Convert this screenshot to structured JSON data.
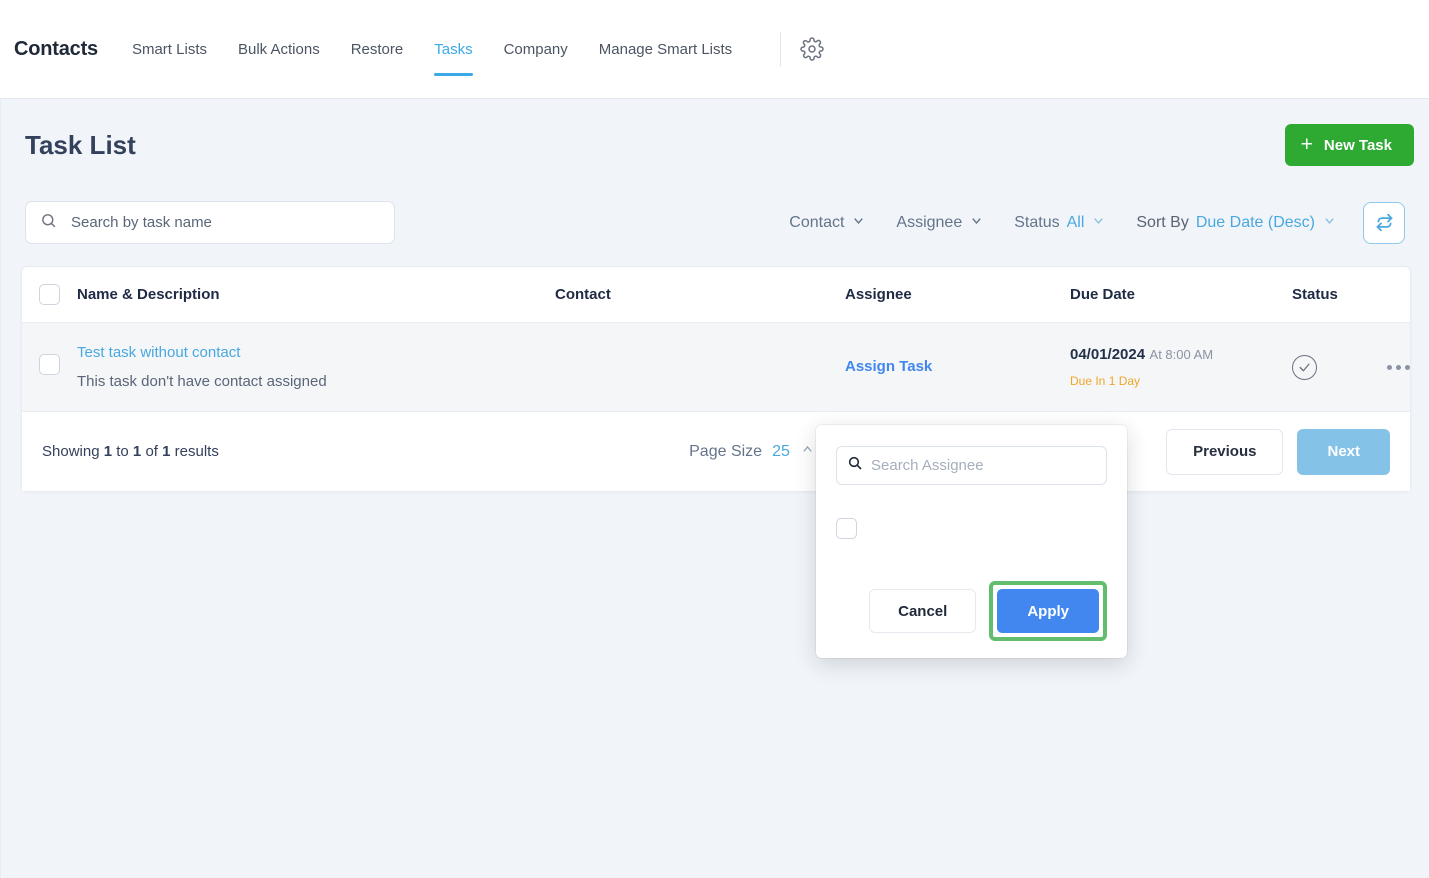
{
  "nav": {
    "brand": "Contacts",
    "items": [
      {
        "label": "Smart Lists",
        "active": false
      },
      {
        "label": "Bulk Actions",
        "active": false
      },
      {
        "label": "Restore",
        "active": false
      },
      {
        "label": "Tasks",
        "active": true
      },
      {
        "label": "Company",
        "active": false
      },
      {
        "label": "Manage Smart Lists",
        "active": false
      }
    ],
    "settings_icon": "gear-icon"
  },
  "header": {
    "title": "Task List",
    "new_task_label": "New Task",
    "new_task_icon": "plus-icon",
    "new_task_color": "#2eaa33"
  },
  "filters": {
    "search_placeholder": "Search by task name",
    "search_value": "",
    "search_icon": "search-icon",
    "contact_label": "Contact",
    "assignee_label": "Assignee",
    "status_label": "Status",
    "status_value": "All",
    "sort_label": "Sort By",
    "sort_value": "Due Date (Desc)",
    "refresh_icon": "refresh-icon",
    "accent_color": "#4aa8e0"
  },
  "table": {
    "columns": {
      "name": "Name & Description",
      "contact": "Contact",
      "assignee": "Assignee",
      "due_date": "Due Date",
      "status": "Status"
    },
    "rows": [
      {
        "name": "Test task without contact",
        "description": "This task don't have contact assigned",
        "contact": "",
        "assignee": "Assign Task",
        "due_date": "04/01/2024",
        "due_time": "At 8:00 AM",
        "due_note": "Due In 1 Day",
        "status_icon": "check-circle-icon",
        "more_icon": "ellipsis-icon"
      }
    ]
  },
  "pagination": {
    "showing_prefix": "Showing",
    "showing_from": "1",
    "showing_to_word": "to",
    "showing_to": "1",
    "showing_of_word": "of",
    "showing_total": "1",
    "showing_suffix": "results",
    "page_size_label": "Page Size",
    "page_size_value": "25",
    "previous_label": "Previous",
    "next_label": "Next"
  },
  "assignee_popover": {
    "search_placeholder": "Search Assignee",
    "search_value": "",
    "search_icon": "search-icon",
    "cancel_label": "Cancel",
    "apply_label": "Apply",
    "apply_color": "#4287f0",
    "highlight_color": "#63bd6f"
  }
}
